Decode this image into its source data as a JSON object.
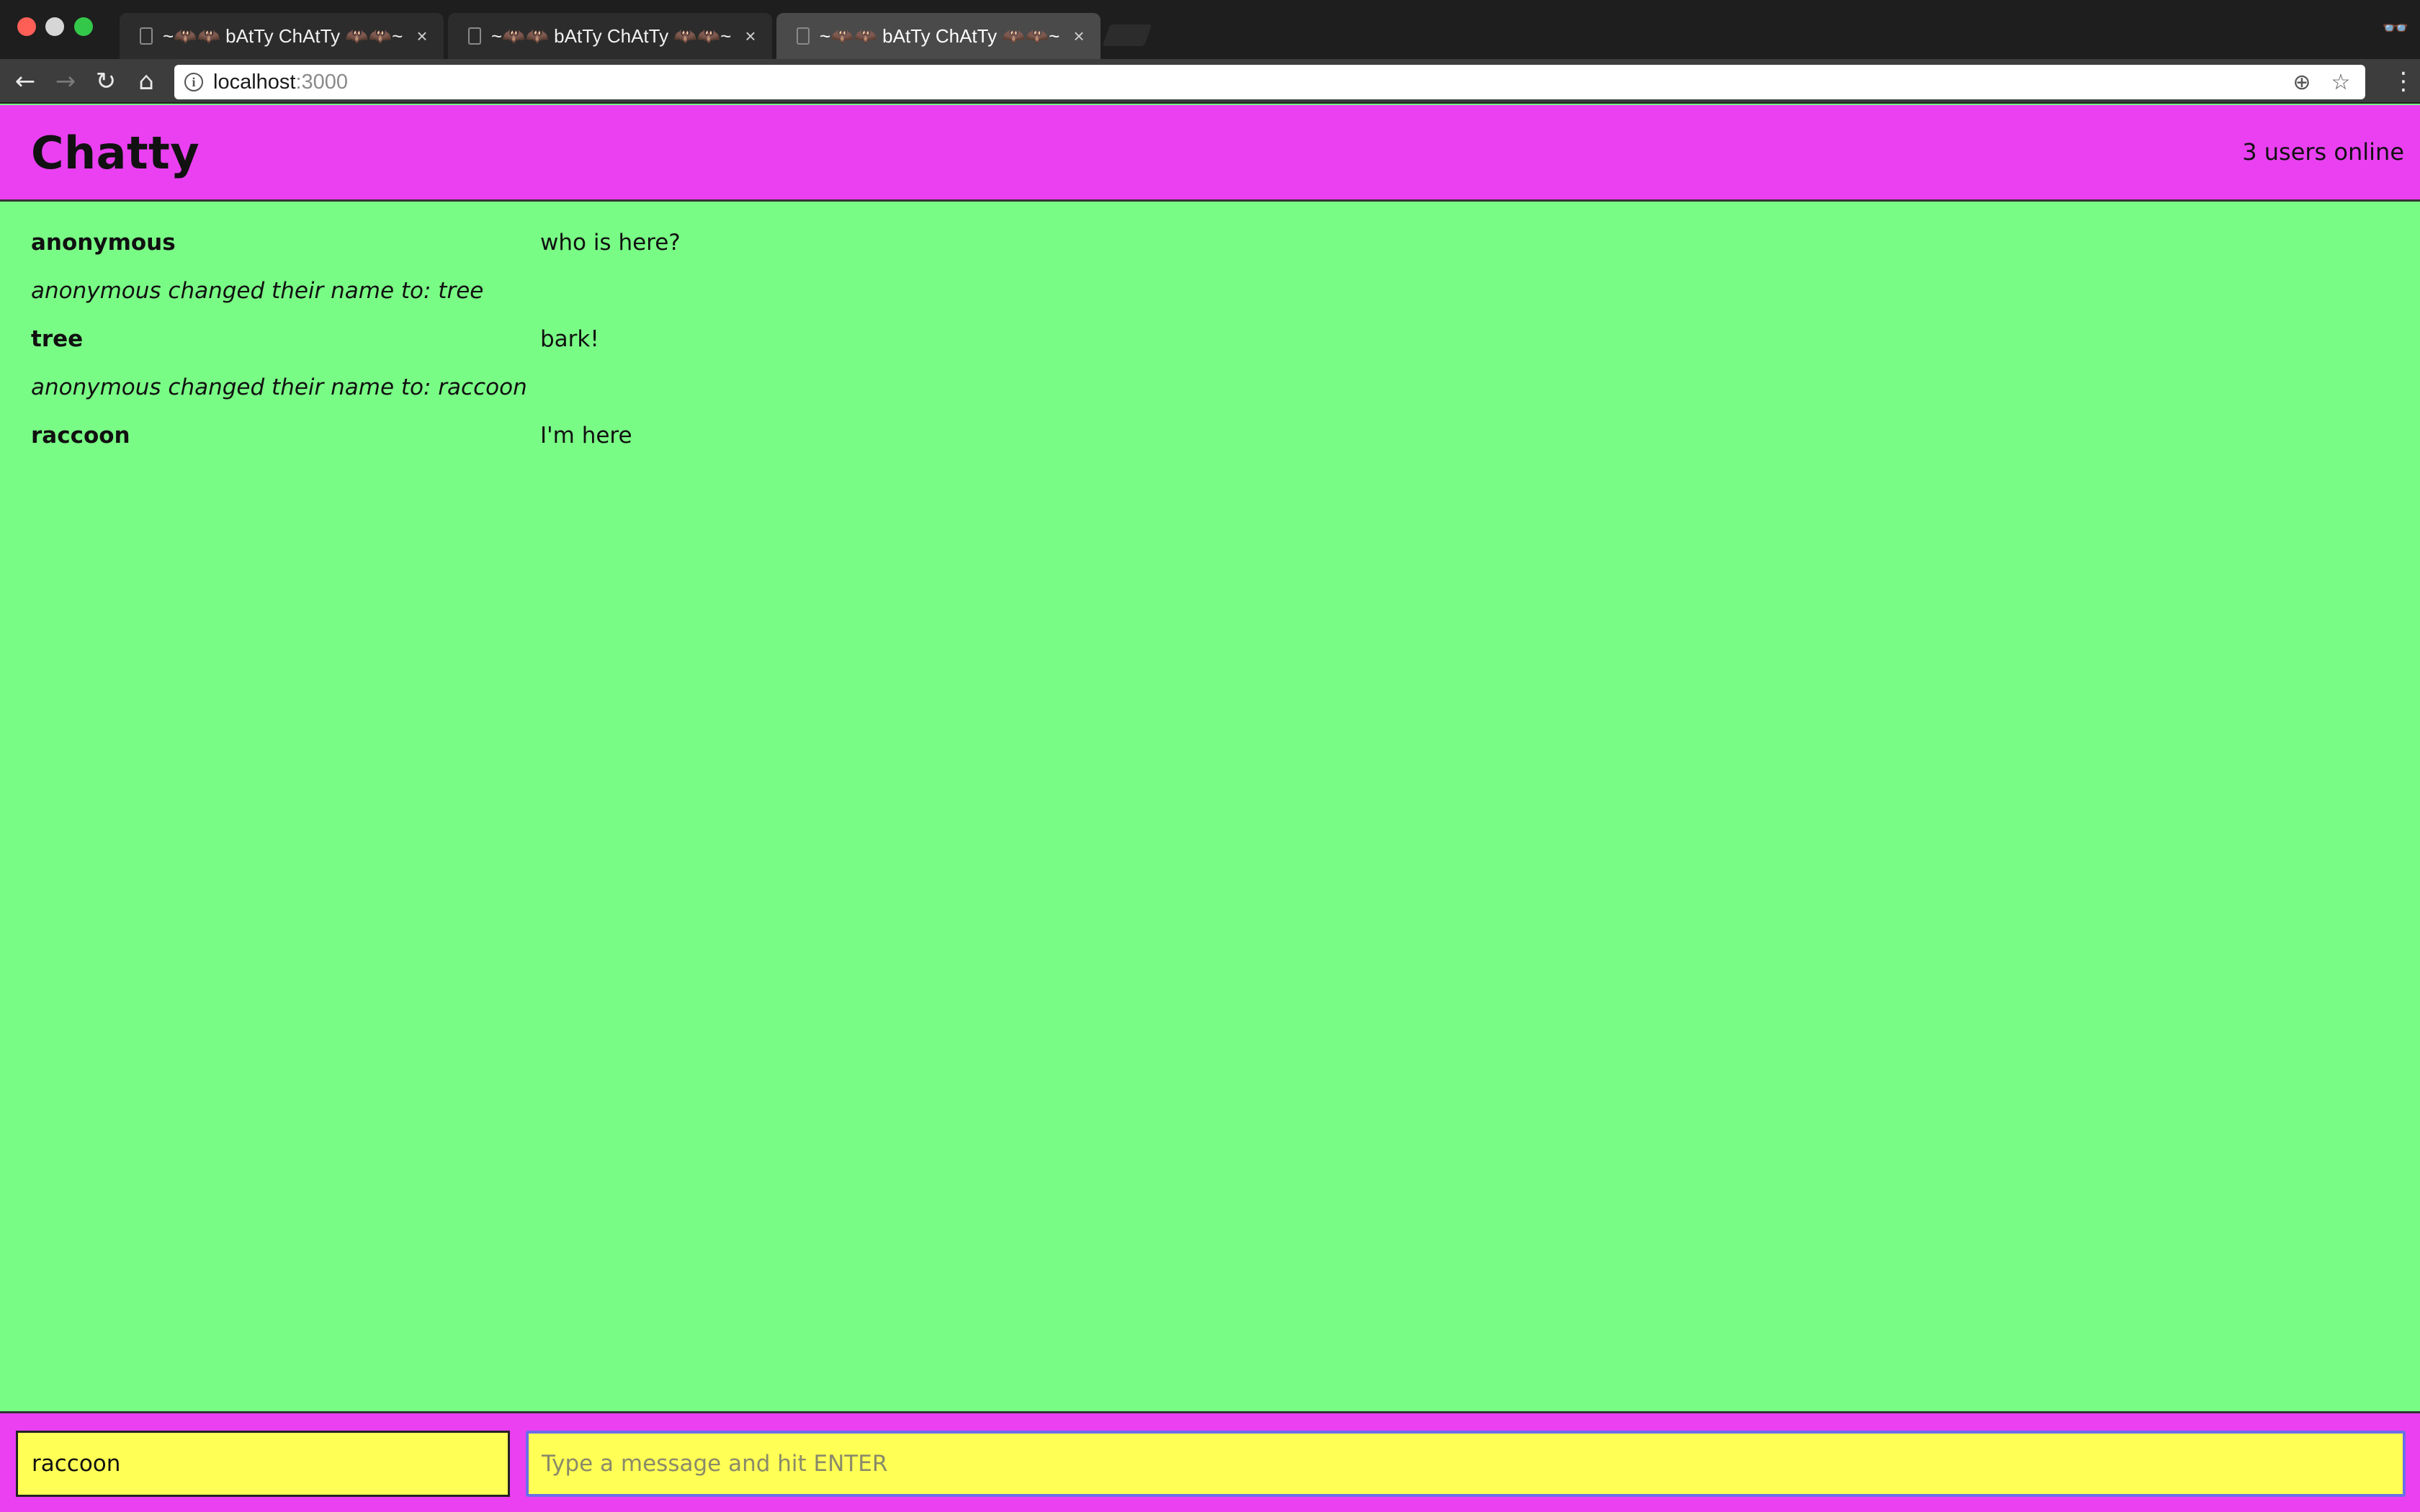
{
  "browser": {
    "tabs": [
      {
        "title": "~🦇🦇 bAtTy ChAtTy 🦇🦇~",
        "active": false
      },
      {
        "title": "~🦇🦇 bAtTy ChAtTy 🦇🦇~",
        "active": false
      },
      {
        "title": "~🦇🦇 bAtTy ChAtTy 🦇🦇~",
        "active": true
      }
    ],
    "tab_close_glyph": "×",
    "url_host": "localhost",
    "url_port": ":3000",
    "icons": {
      "back": "←",
      "forward": "→",
      "reload": "↻",
      "home": "⌂",
      "info": "i",
      "zoom": "⊕",
      "star": "☆",
      "menu": "⋮",
      "incognito": "👓"
    }
  },
  "header": {
    "title": "Chatty",
    "online": "3 users online"
  },
  "messages": [
    {
      "type": "message",
      "user": "anonymous",
      "text": "who is here?"
    },
    {
      "type": "notification",
      "text": "anonymous changed their name to: tree"
    },
    {
      "type": "message",
      "user": "tree",
      "text": "bark!"
    },
    {
      "type": "notification",
      "text": "anonymous changed their name to: raccoon"
    },
    {
      "type": "message",
      "user": "raccoon",
      "text": "I'm here"
    }
  ],
  "chatbar": {
    "username_value": "raccoon",
    "message_placeholder": "Type a message and hit ENTER",
    "message_value": ""
  },
  "colors": {
    "header_bg": "#ea40f2",
    "messages_bg": "#79fc85",
    "input_bg": "#ffff55",
    "focus_border": "#6a6ee8"
  }
}
